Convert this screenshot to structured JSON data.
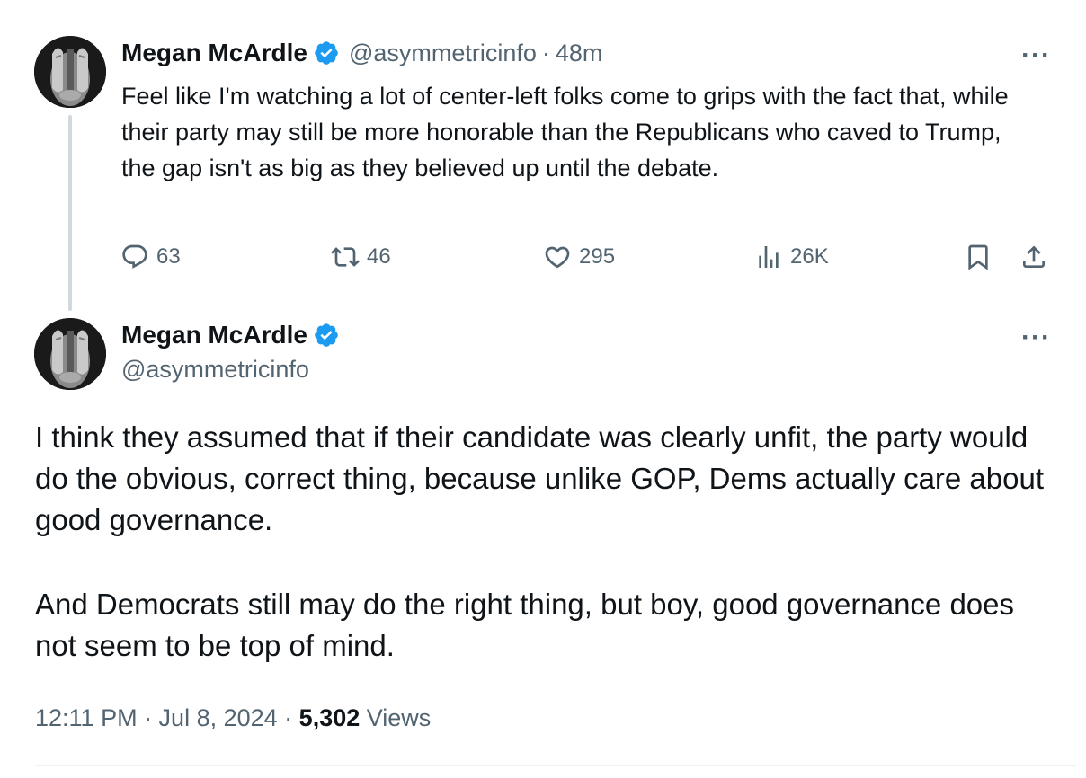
{
  "reply_tweet": {
    "author_name": "Megan McArdle",
    "handle": "@asymmetricinfo",
    "separator": "·",
    "time_ago": "48m",
    "more_label": "···",
    "text": "Feel like I'm watching a lot of center-left folks come to grips with the fact that, while their party may still be more honorable than the Republicans who caved to Trump, the gap isn't as big as they believed up until the debate.",
    "actions": {
      "replies": "63",
      "reposts": "46",
      "likes": "295",
      "views": "26K"
    },
    "icons": [
      "reply-icon",
      "repost-icon",
      "like-icon",
      "views-icon",
      "bookmark-icon",
      "share-icon"
    ]
  },
  "main_tweet": {
    "author_name": "Megan McArdle",
    "handle": "@asymmetricinfo",
    "more_label": "···",
    "paragraphs": [
      "I think they assumed that if their candidate was clearly unfit, the party would do the obvious, correct thing, because unlike GOP, Dems actually care about good governance.",
      "And Democrats still may do the right thing, but boy, good governance does not seem to be top of mind."
    ],
    "timestamp": "12:11 PM · Jul 8, 2024 ·",
    "view_count": "5,302",
    "views_label": "Views"
  },
  "colors": {
    "verified_blue": "#1d9bf0",
    "secondary_text": "#536471",
    "primary_text": "#0f1419",
    "thread_line": "#cfd9de"
  }
}
